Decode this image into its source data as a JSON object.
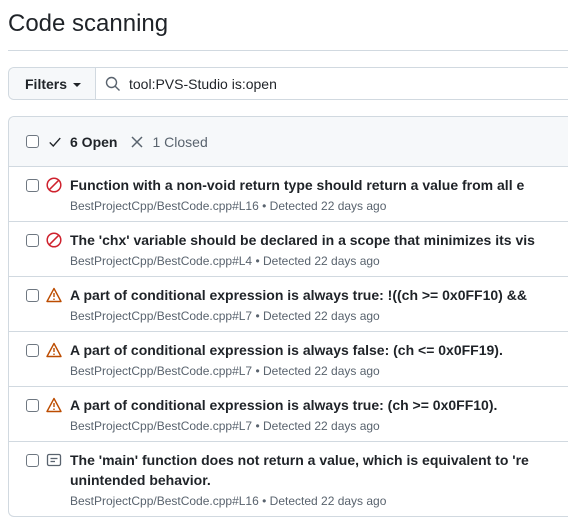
{
  "page": {
    "title": "Code scanning"
  },
  "filter": {
    "button_label": "Filters",
    "query": "tool:PVS-Studio is:open"
  },
  "list": {
    "open_label": "6 Open",
    "closed_label": "1 Closed"
  },
  "colors": {
    "error": "#cf222e",
    "warning": "#bc4c00",
    "note": "#59636e"
  },
  "alerts": [
    {
      "severity": "error",
      "icon": "stop-icon",
      "title": "Function with a non-void return type should return a value from all e",
      "meta": "BestProjectCpp/BestCode.cpp#L16 • Detected 22 days ago"
    },
    {
      "severity": "error",
      "icon": "stop-icon",
      "title": "The 'chx' variable should be declared in a scope that minimizes its vis",
      "meta": "BestProjectCpp/BestCode.cpp#L4 • Detected 22 days ago"
    },
    {
      "severity": "warning",
      "icon": "alert-icon",
      "title": "A part of conditional expression is always true: !((ch >= 0x0FF10) &&",
      "meta": "BestProjectCpp/BestCode.cpp#L7 • Detected 22 days ago"
    },
    {
      "severity": "warning",
      "icon": "alert-icon",
      "title": "A part of conditional expression is always false: (ch <= 0x0FF19).",
      "meta": "BestProjectCpp/BestCode.cpp#L7 • Detected 22 days ago"
    },
    {
      "severity": "warning",
      "icon": "alert-icon",
      "title": "A part of conditional expression is always true: (ch >= 0x0FF10).",
      "meta": "BestProjectCpp/BestCode.cpp#L7 • Detected 22 days ago"
    },
    {
      "severity": "note",
      "icon": "note-icon",
      "title": "The 'main' function does not return a value, which is equivalent to 're",
      "title_line2": "unintended behavior.",
      "meta": "BestProjectCpp/BestCode.cpp#L16 • Detected 22 days ago"
    }
  ]
}
